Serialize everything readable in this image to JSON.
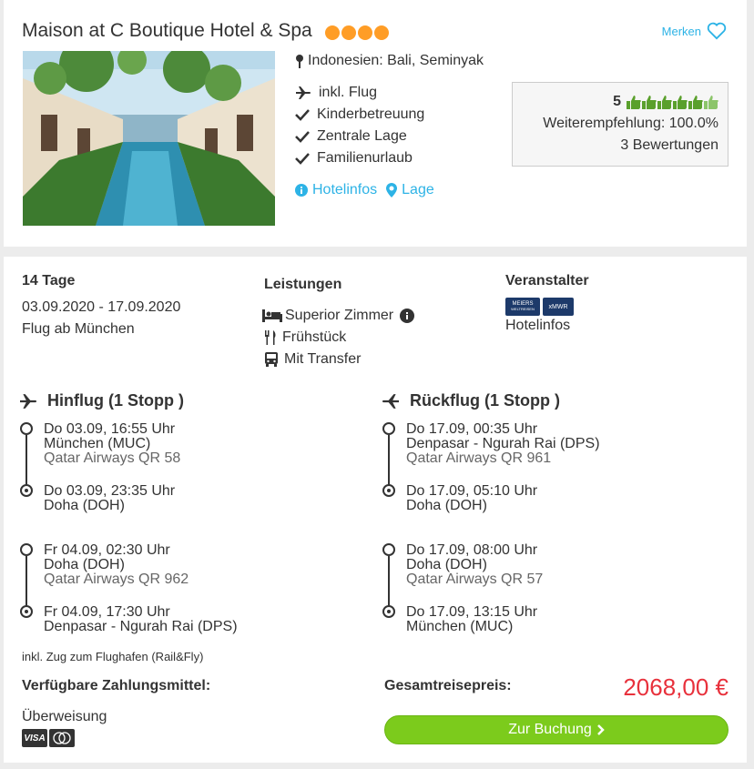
{
  "hotel": {
    "name": "Maison at C Boutique Hotel & Spa",
    "star_count": 4,
    "bookmark_label": "Merken",
    "location": "Indonesien: Bali, Seminyak",
    "features": [
      "inkl. Flug",
      "Kinderbetreuung",
      "Zentrale Lage",
      "Familienurlaub"
    ],
    "links": {
      "info": "Hotelinfos",
      "location": "Lage"
    }
  },
  "rating": {
    "score": "5",
    "thumbs_count": 6,
    "recommendation": "Weiterempfehlung: 100.0%",
    "reviews": "3 Bewertungen"
  },
  "trip": {
    "duration": "14 Tage",
    "dates": "03.09.2020 - 17.09.2020",
    "departure": "Flug ab München"
  },
  "services": {
    "heading": "Leistungen",
    "room": "Superior Zimmer",
    "board": "Frühstück",
    "transfer": "Mit Transfer"
  },
  "operator": {
    "heading": "Veranstalter",
    "logo1": "MEIERS",
    "logo1_sub": "WELTREISEN",
    "logo2": "xMWR",
    "link": "Hotelinfos"
  },
  "outbound": {
    "title": "Hinflug (1 Stopp )",
    "segments": [
      {
        "dep_time": "Do 03.09, 16:55 Uhr",
        "dep_airport": "München (MUC)",
        "airline": "Qatar Airways QR 58",
        "arr_time": "Do 03.09, 23:35 Uhr",
        "arr_airport": "Doha (DOH)"
      },
      {
        "dep_time": "Fr 04.09, 02:30 Uhr",
        "dep_airport": "Doha (DOH)",
        "airline": "Qatar Airways QR 962",
        "arr_time": "Fr 04.09, 17:30 Uhr",
        "arr_airport": "Denpasar - Ngurah Rai (DPS)"
      }
    ]
  },
  "return": {
    "title": "Rückflug (1 Stopp )",
    "segments": [
      {
        "dep_time": "Do 17.09, 00:35 Uhr",
        "dep_airport": "Denpasar - Ngurah Rai (DPS)",
        "airline": "Qatar Airways QR 961",
        "arr_time": "Do 17.09, 05:10 Uhr",
        "arr_airport": "Doha (DOH)"
      },
      {
        "dep_time": "Do 17.09, 08:00 Uhr",
        "dep_airport": "Doha (DOH)",
        "airline": "Qatar Airways QR 57",
        "arr_time": "Do 17.09, 13:15 Uhr",
        "arr_airport": "München (MUC)"
      }
    ]
  },
  "rail_note": "inkl. Zug zum Flughafen (Rail&Fly)",
  "payment": {
    "heading": "Verfügbare Zahlungsmittel:",
    "method": "Überweisung",
    "visa": "VISA"
  },
  "total": {
    "label": "Gesamtreisepreis:",
    "price": "2068,00 €",
    "button": "Zur Buchung"
  },
  "colors": {
    "accent": "#2db3e6",
    "price": "#e8313c",
    "button": "#7ccb1c",
    "stars": "#ff9d26",
    "thumbs": "#5aa02c"
  }
}
